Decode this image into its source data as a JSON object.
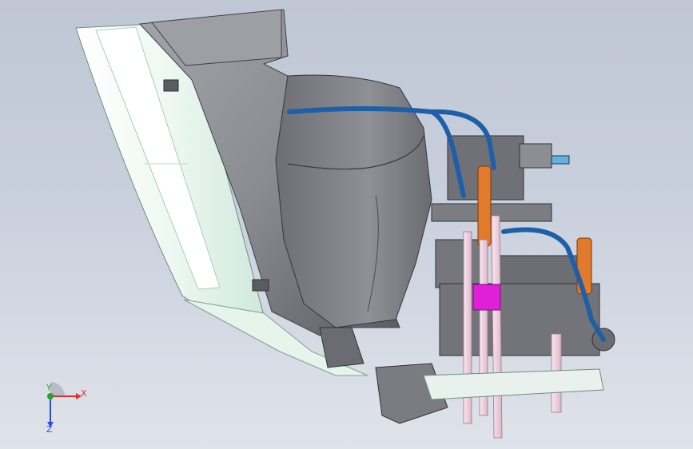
{
  "viewport": {
    "colors": {
      "background_top": "#bfc6d4",
      "background_bottom": "#dfe3ea",
      "housing": "#8d8f94",
      "housing_dark": "#5e6066",
      "lens": "#e9f6ef",
      "lens_edge": "#c6e6d2",
      "wire": "#1f5fa8",
      "accent_orange": "#e07a2c",
      "accent_magenta": "#e020d8",
      "rod": "#f3d8e6"
    }
  },
  "triad": {
    "x_label": "X",
    "y_label": "Y",
    "z_label": "Z",
    "x_color": "#e03030",
    "y_color": "#2ca02c",
    "z_color": "#2b4fd0"
  }
}
